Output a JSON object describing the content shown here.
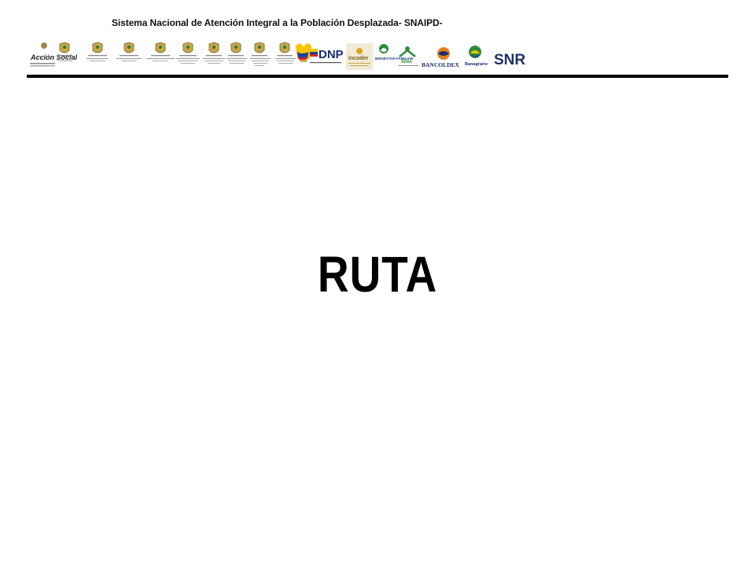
{
  "header": {
    "title": "Sistema Nacional de Atención Integral a la Población Desplazada- SNAIPD-"
  },
  "logos": {
    "accion_social": "Acción Social",
    "dnp": "DNP",
    "incoder": "incoder",
    "bienestar": "BIENESTAR FAMILIAR",
    "sena": "SENA",
    "bancoldex": "BANCOLDEX",
    "banagrario": "Banagrario",
    "snr": "SNR"
  },
  "slide": {
    "title": "RUTA"
  },
  "colors": {
    "rule": "#000000",
    "dnp_blue": "#1a2a6c",
    "flag_yellow": "#f5c400",
    "flag_blue": "#1f3f9a",
    "flag_red": "#d5202a",
    "sena_green": "#2e8b3a",
    "snr_navy": "#1c2f6b",
    "bancoldex_orange": "#e67e22"
  }
}
